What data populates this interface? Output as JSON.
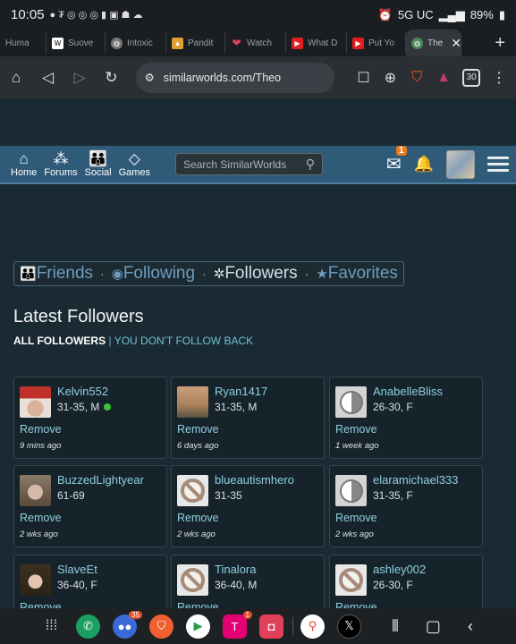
{
  "status_bar": {
    "time": "10:05",
    "network": "5G UC",
    "battery": "89%"
  },
  "tabs": [
    {
      "label": "Huma",
      "color": "#666"
    },
    {
      "label": "Suove",
      "color": "#ddd"
    },
    {
      "label": "Intoxic",
      "color": "#ccc"
    },
    {
      "label": "Pandit",
      "color": "#e0a030"
    },
    {
      "label": "Watch",
      "color": "#e04060"
    },
    {
      "label": "What D",
      "color": "#e02020"
    },
    {
      "label": "Put Yo",
      "color": "#e02020"
    },
    {
      "label": "The",
      "color": "#4a8a5a"
    }
  ],
  "urlbar": {
    "url": "similarworlds.com/Theo",
    "tab_count": "30"
  },
  "site_nav": {
    "home": "Home",
    "forums": "Forums",
    "social": "Social",
    "games": "Games",
    "search_placeholder": "Search SimilarWorlds",
    "mail_badge": "1"
  },
  "filters": {
    "friends": "Friends",
    "following": "Following",
    "followers": "Followers",
    "favorites": "Favorites"
  },
  "page_title": "Latest Followers",
  "subnav": {
    "all": "ALL FOLLOWERS",
    "sep": "|",
    "not_followed": "YOU DON'T FOLLOW BACK"
  },
  "remove_label": "Remove",
  "followers": [
    {
      "name": "Kelvin552",
      "age": "31-35, M",
      "when": "9 mins ago",
      "online": true
    },
    {
      "name": "Ryan1417",
      "age": "31-35, M",
      "when": "6 days ago",
      "online": false
    },
    {
      "name": "AnabelleBliss",
      "age": "26-30, F",
      "when": "1 week ago",
      "online": false
    },
    {
      "name": "BuzzedLightyear",
      "age": "61-69",
      "when": "2 wks ago",
      "online": false
    },
    {
      "name": "blueautismhero",
      "age": "31-35",
      "when": "2 wks ago",
      "online": false
    },
    {
      "name": "elaramichael333",
      "age": "31-35, F",
      "when": "2 wks ago",
      "online": false
    },
    {
      "name": "SlaveEt",
      "age": "36-40, F",
      "when": "",
      "online": false
    },
    {
      "name": "Tinalora",
      "age": "36-40, M",
      "when": "",
      "online": false
    },
    {
      "name": "ashley002",
      "age": "26-30, F",
      "when": "",
      "online": false
    }
  ],
  "dock": {
    "messages_badge": "35",
    "tmobile_badge": "1"
  }
}
